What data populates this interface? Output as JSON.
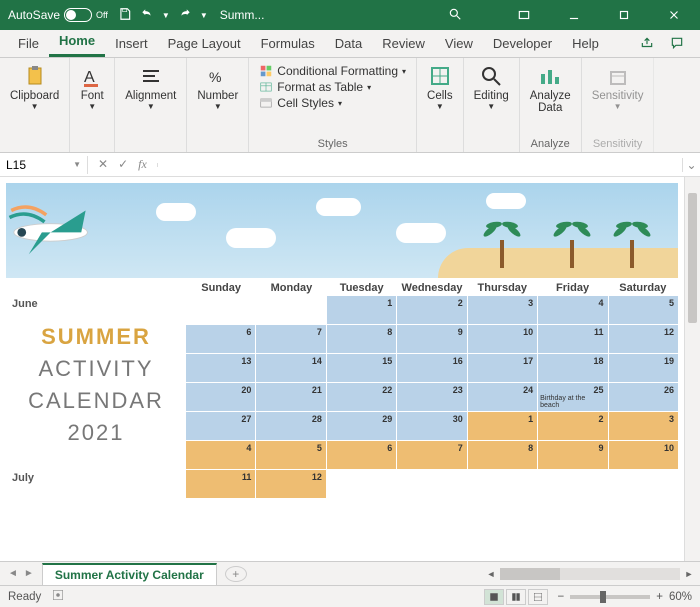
{
  "titlebar": {
    "autosave_label": "AutoSave",
    "autosave_state": "Off",
    "doc_title": "Summ..."
  },
  "tabs": {
    "file": "File",
    "home": "Home",
    "insert": "Insert",
    "page_layout": "Page Layout",
    "formulas": "Formulas",
    "data": "Data",
    "review": "Review",
    "view": "View",
    "developer": "Developer",
    "help": "Help"
  },
  "ribbon": {
    "clipboard": {
      "label": "Clipboard"
    },
    "font": {
      "label": "Font"
    },
    "alignment": {
      "label": "Alignment"
    },
    "number": {
      "label": "Number"
    },
    "styles": {
      "label": "Styles",
      "cond_fmt": "Conditional Formatting",
      "as_table": "Format as Table",
      "cell_styles": "Cell Styles"
    },
    "cells": {
      "label": "Cells"
    },
    "editing": {
      "label": "Editing"
    },
    "analyze": {
      "label": "Analyze",
      "btn": "Analyze\nData"
    },
    "sensitivity": {
      "label": "Sensitivity",
      "btn": "Sensitivity"
    }
  },
  "namebox": {
    "cell": "L15"
  },
  "calendar": {
    "weekdays": [
      "Sunday",
      "Monday",
      "Tuesday",
      "Wednesday",
      "Thursday",
      "Friday",
      "Saturday"
    ],
    "months": {
      "june": "June",
      "july": "July"
    },
    "title": {
      "l1": "SUMMER",
      "l2": "ACTIVITY",
      "l3": "CALENDAR",
      "l4": "2021"
    },
    "note": "Birthday at the beach"
  },
  "sheettabs": {
    "active": "Summer Activity Calendar"
  },
  "status": {
    "ready": "Ready",
    "zoom": "60%"
  }
}
